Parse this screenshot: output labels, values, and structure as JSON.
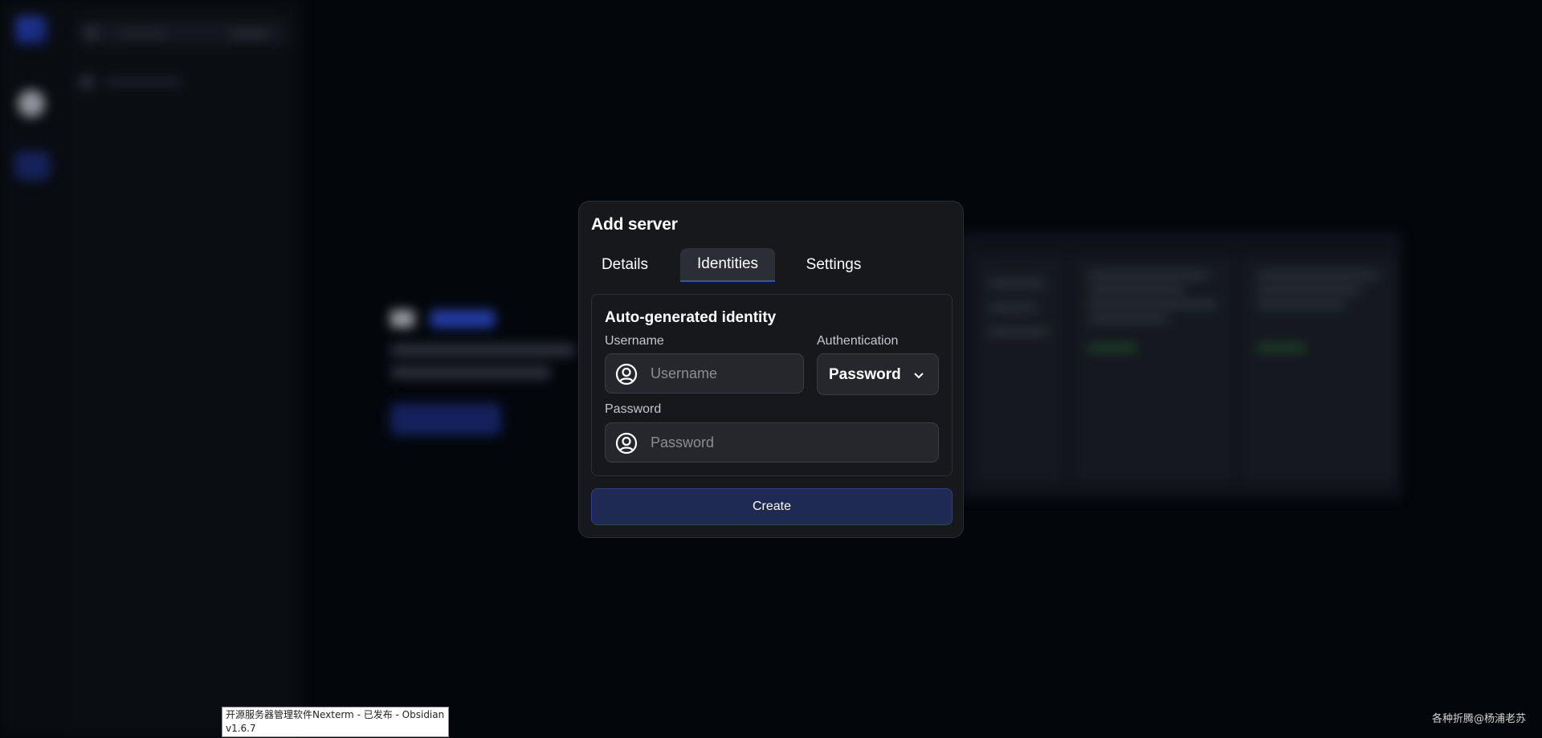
{
  "modal": {
    "title": "Add server",
    "tabs": [
      {
        "label": "Details"
      },
      {
        "label": "Identities"
      },
      {
        "label": "Settings"
      }
    ],
    "active_tab": "Identities",
    "identity_card": {
      "title": "Auto-generated identity",
      "username_label": "Username",
      "username_placeholder": "Username",
      "username_value": "",
      "authentication_label": "Authentication",
      "authentication_value": "Password",
      "password_label": "Password",
      "password_placeholder": "Password",
      "password_value": ""
    },
    "create_label": "Create"
  },
  "tooltip": {
    "line1": "开源服务器管理软件Nexterm - 已发布 - Obsidian",
    "line2": "v1.6.7"
  },
  "watermark": "各种折腾@杨浦老苏",
  "icons": {
    "username_field_icon": "user-circle-icon",
    "password_field_icon": "user-circle-icon",
    "authentication_dropdown_icon": "chevron-down-icon"
  },
  "colors": {
    "background": "#03070c",
    "modal_background": "#16181c",
    "accent": "#2f4fd9",
    "create_button": "#1e2a52"
  }
}
